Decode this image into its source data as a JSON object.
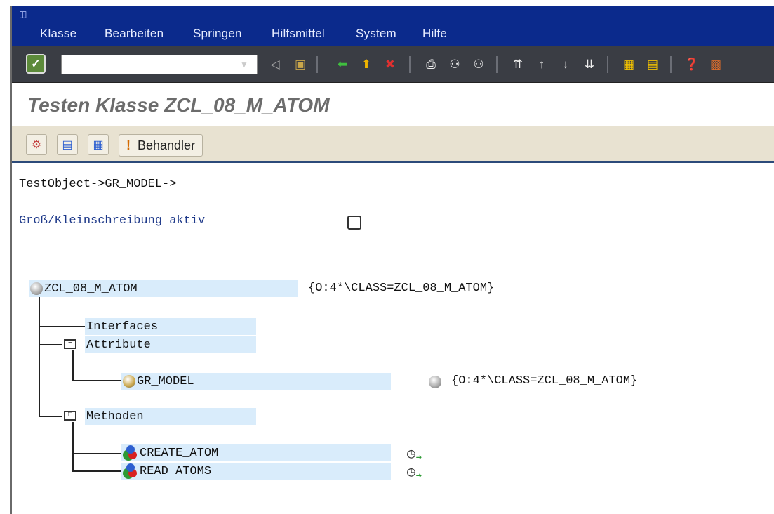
{
  "menubar": {
    "items": [
      "Klasse",
      "Bearbeiten",
      "Springen",
      "Hilfsmittel",
      "System",
      "Hilfe"
    ]
  },
  "toolbar": {
    "command_field_value": ""
  },
  "title": "Testen Klasse ZCL_08_M_ATOM",
  "app_toolbar": {
    "handler_label": "Behandler"
  },
  "content": {
    "path": "TestObject->GR_MODEL->",
    "case_sensitive_label": "Groß/Kleinschreibung aktiv",
    "tree": {
      "root_label": "ZCL_08_M_ATOM",
      "root_value": "{O:4*\\CLASS=ZCL_08_M_ATOM}",
      "interfaces_label": "Interfaces",
      "attribute_label": "Attribute",
      "attribute_item_label": "GR_MODEL",
      "attribute_item_value": "{O:4*\\CLASS=ZCL_08_M_ATOM}",
      "methods_label": "Methoden",
      "method_items": [
        "CREATE_ATOM",
        "READ_ATOMS"
      ]
    }
  },
  "colors": {
    "menubar_bg": "#0b2a8c",
    "toolbar_bg": "#3a3d44",
    "app_toolbar_bg": "#e8e2d1",
    "node_highlight": "#d9ecfb"
  }
}
